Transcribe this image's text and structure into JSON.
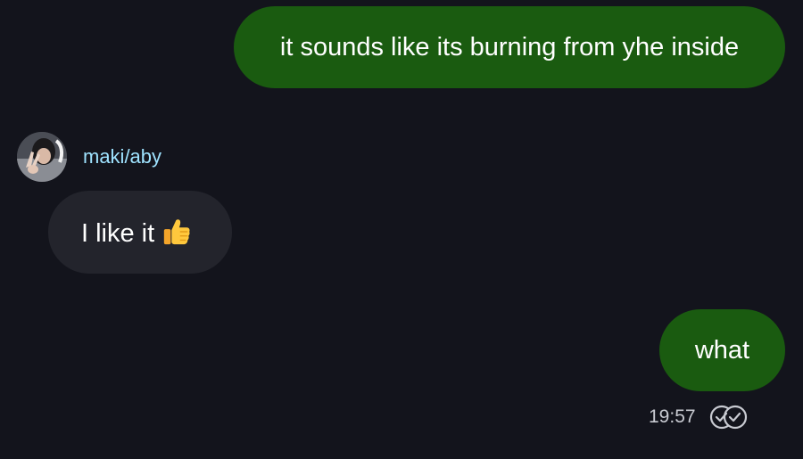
{
  "messages": {
    "outgoing_1": {
      "text": "it sounds like its burning from yhe inside"
    },
    "incoming_1": {
      "sender": "maki/aby",
      "text": "I like it",
      "emoji": "thumbs-up-emoji"
    },
    "outgoing_2": {
      "text": "what",
      "time": "19:57",
      "status_icon": "double-check-icon"
    }
  },
  "colors": {
    "background": "#13141c",
    "outgoing_bubble": "#1a5b10",
    "incoming_bubble": "#23242c",
    "sender_name": "#9fe3ff",
    "timestamp": "#c9cbd2"
  }
}
